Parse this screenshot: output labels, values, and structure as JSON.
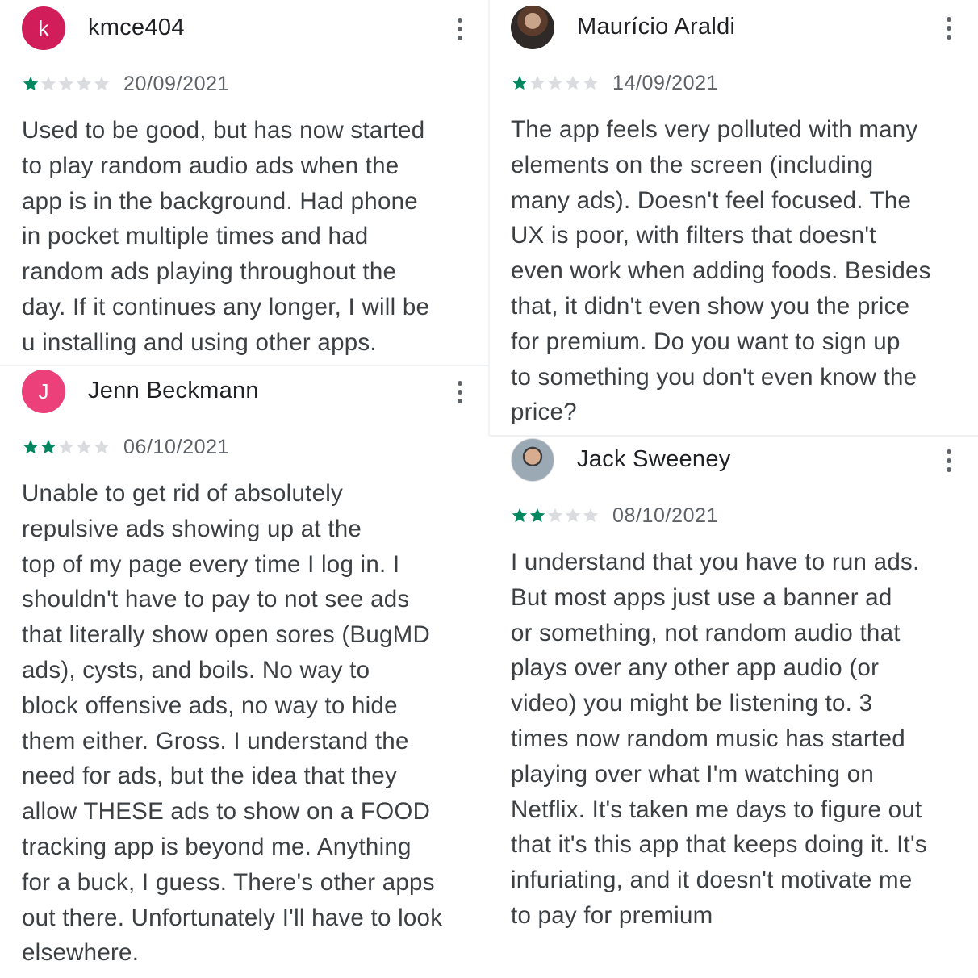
{
  "colors": {
    "star_filled": "#01875f",
    "star_empty": "#dadce0",
    "more_icon": "#5f6368"
  },
  "reviews": [
    {
      "author": "kmce404",
      "avatar": {
        "letter": "k",
        "color": "#d11e5b",
        "icon": "letter-avatar"
      },
      "rating": 1,
      "date": "20/09/2021",
      "text": "Used to be good, but has now started\nto play random audio ads when the\napp is in the background. Had phone\nin pocket multiple times and had\nrandom ads playing throughout the\nday. If it continues any longer, I will be\nu installing and using other apps."
    },
    {
      "author": "Jenn Beckmann",
      "avatar": {
        "letter": "J",
        "color": "#ec407a",
        "icon": "letter-avatar"
      },
      "rating": 2,
      "date": "06/10/2021",
      "text": "Unable to get rid of absolutely\nrepulsive ads showing up at the\ntop of my page every time I log in. I\nshouldn't have to pay to not see ads\nthat literally show open sores (BugMD\nads), cysts, and boils. No way to\nblock offensive ads, no way to hide\nthem either. Gross. I understand the\nneed for ads, but the idea that they\nallow THESE ads to show on a FOOD\ntracking app is beyond me. Anything\nfor a buck, I guess. There's other apps\nout there. Unfortunately I'll have to look\nelsewhere."
    },
    {
      "author": "Maurício Araldi",
      "avatar": {
        "letter": "",
        "color": "#3a302a",
        "icon": "photo-avatar"
      },
      "rating": 1,
      "date": "14/09/2021",
      "text": "The app feels very polluted with many\nelements on the screen (including\nmany ads). Doesn't feel focused. The\nUX is poor, with filters that doesn't\neven work when adding foods. Besides\nthat, it didn't even show you the price\nfor premium. Do you want to sign up\nto something you don't even know the\nprice?"
    },
    {
      "author": "Jack Sweeney",
      "avatar": {
        "letter": "",
        "color": "#9aa9b3",
        "icon": "photo-avatar"
      },
      "rating": 2,
      "date": "08/10/2021",
      "text": "I understand that you have to run ads.\nBut most apps just use a banner ad\nor something, not random audio that\nplays over any other app audio (or\nvideo) you might be listening to. 3\ntimes now random music has started\nplaying over what I'm watching on\nNetflix. It's taken me days to figure out\nthat it's this app that keeps doing it. It's\ninfuriating, and it doesn't motivate me\nto pay for premium"
    }
  ]
}
